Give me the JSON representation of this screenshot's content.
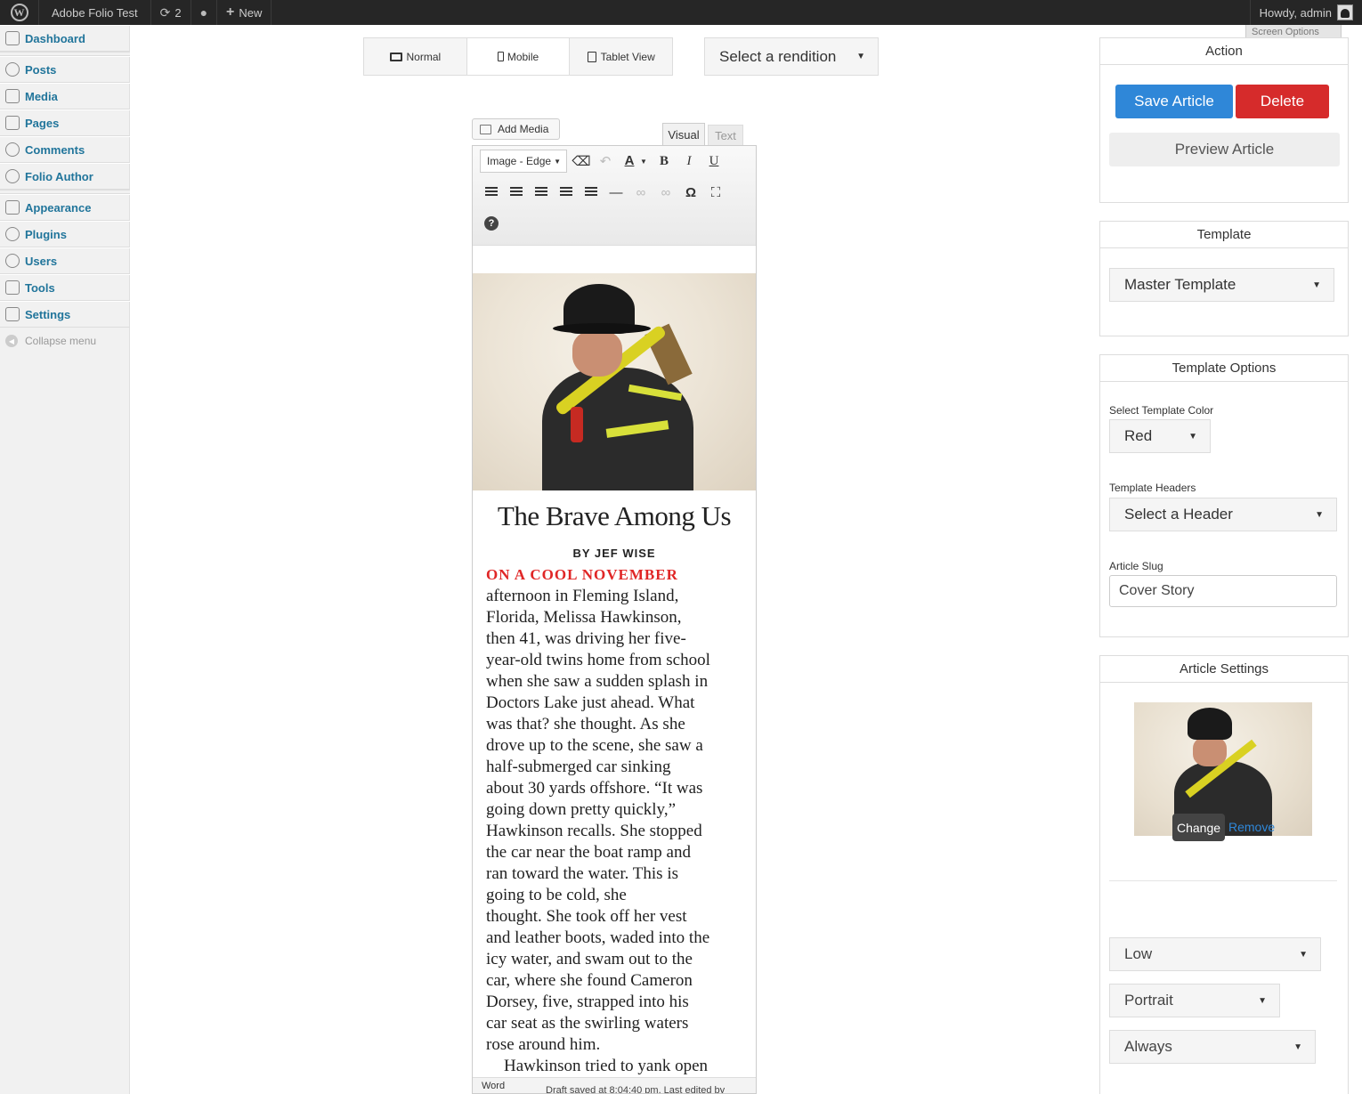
{
  "admin_bar": {
    "site_name": "Adobe Folio Test",
    "updates_count": "2",
    "new_label": "New",
    "greeting": "Howdy, admin",
    "screen_options": "Screen Options"
  },
  "sidebar": {
    "items": [
      {
        "label": "Dashboard",
        "icon": "dashboard-icon"
      },
      {
        "label": "Posts",
        "icon": "pin-icon"
      },
      {
        "label": "Media",
        "icon": "media-icon"
      },
      {
        "label": "Pages",
        "icon": "pages-icon"
      },
      {
        "label": "Comments",
        "icon": "comment-icon"
      },
      {
        "label": "Folio Author",
        "icon": "gear-icon"
      },
      {
        "label": "Appearance",
        "icon": "appearance-icon"
      },
      {
        "label": "Plugins",
        "icon": "plug-icon"
      },
      {
        "label": "Users",
        "icon": "users-icon"
      },
      {
        "label": "Tools",
        "icon": "tools-icon"
      },
      {
        "label": "Settings",
        "icon": "settings-icon"
      }
    ],
    "collapse_label": "Collapse menu"
  },
  "view_toggle": {
    "normal": "Normal",
    "mobile": "Mobile",
    "tablet": "Tablet View",
    "active": "mobile"
  },
  "rendition_select": "Select a rendition",
  "editor": {
    "add_media": "Add Media",
    "tab_visual": "Visual",
    "tab_text": "Text",
    "format_select": "Image - Edge",
    "toolbar_icons": [
      "eraser-icon",
      "undo-icon",
      "text-color-icon",
      "bold-icon",
      "italic-icon",
      "underline-icon",
      "align-left-icon",
      "align-center-icon",
      "align-right-icon",
      "bullet-list-icon",
      "numbered-list-icon",
      "horizontal-rule-icon",
      "link-icon",
      "unlink-icon",
      "omega-icon",
      "fullscreen-icon",
      "help-icon"
    ],
    "bold_glyph": "B",
    "italic_glyph": "I",
    "underline_glyph": "U",
    "omega_glyph": "Ω",
    "help_glyph": "?",
    "text_color_glyph": "A",
    "article_title": "The Brave Among Us",
    "byline": "BY JEF WISE",
    "lead_in": "ON A COOL NOVEMBER",
    "body_lines": [
      "afternoon in Fleming Island,",
      "Florida, Melissa Hawkinson,",
      "then 41, was driving her five-",
      "year-old twins home from school",
      "when she saw a sudden splash in",
      "Doctors Lake just ahead. What",
      "was that? she thought. As she",
      "drove up to the scene, she saw a",
      "half-submerged car sinking",
      "about 30 yards offshore. “It was",
      "going down pretty quickly,”",
      "Hawkinson recalls. She stopped",
      "the car near the boat ramp and",
      "ran toward the water. This is",
      "going to be cold, she",
      "thought. She took off her vest",
      "and leather boots, waded into the",
      "icy water, and swam out to the",
      "car, where she found Cameron",
      "Dorsey, five, strapped into his",
      "car seat as the swirling waters",
      "rose around him."
    ],
    "para2_first_line": "Hawkinson tried to yank open",
    "word_label": "Word",
    "draft_status": "Draft saved at 8:04:40 pm. Last edited by"
  },
  "action_panel": {
    "title": "Action",
    "save": "Save Article",
    "delete": "Delete",
    "preview": "Preview Article"
  },
  "template_panel": {
    "title": "Template",
    "selected": "Master Template"
  },
  "template_options": {
    "title": "Template Options",
    "color_label": "Select Template Color",
    "color_value": "Red",
    "headers_label": "Template Headers",
    "headers_value": "Select a Header",
    "slug_label": "Article Slug",
    "slug_value": "Cover Story"
  },
  "article_settings": {
    "title": "Article Settings",
    "change": "Change",
    "remove": "Remove",
    "select1": "Low",
    "select2": "Portrait",
    "select3": "Always"
  },
  "colors": {
    "accent_blue": "#2f87d8",
    "delete_red": "#d62b2b",
    "lead_red": "#e02626",
    "admin_bar": "#262626",
    "sidebar_link": "#21759b"
  }
}
